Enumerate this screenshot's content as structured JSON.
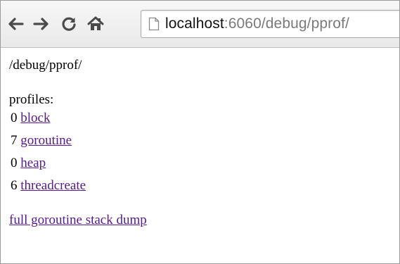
{
  "browser": {
    "url_host": "localhost",
    "url_rest": ":6060/debug/pprof/"
  },
  "page": {
    "path": "/debug/pprof/",
    "profiles_label": "profiles:",
    "profiles": [
      {
        "count": "0",
        "name": "block"
      },
      {
        "count": "7",
        "name": "goroutine"
      },
      {
        "count": "0",
        "name": "heap"
      },
      {
        "count": "6",
        "name": "threadcreate"
      }
    ],
    "dump_link": "full goroutine stack dump"
  },
  "colors": {
    "link_visited": "#551a8b",
    "toolbar": "#ececec"
  },
  "icons": [
    "back-arrow-icon",
    "forward-arrow-icon",
    "reload-icon",
    "home-icon",
    "page-icon"
  ]
}
